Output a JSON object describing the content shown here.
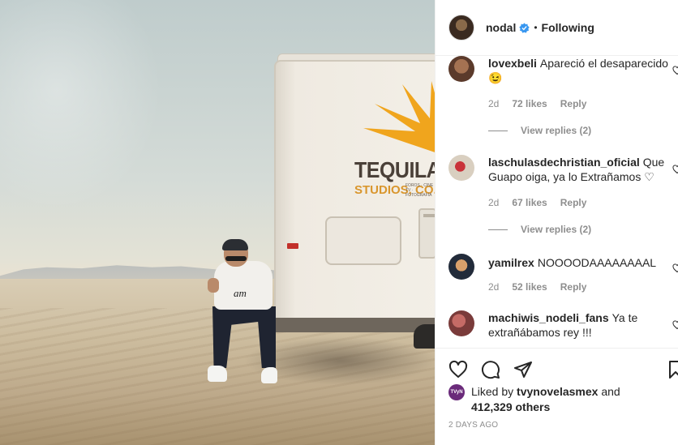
{
  "post": {
    "author": "nodal",
    "follow_state": "Following",
    "separator": "•",
    "image": {
      "trailer_brand": "TEQUILA FILM",
      "trailer_sub": "STUDIOS, CO.",
      "trailer_tiny": "FOROS · CINE · TV · FOTOGRAFÍA",
      "shirt_print": "am"
    },
    "comments": [
      {
        "user": "lovexbeli",
        "text": "Apareció el desaparecido😉",
        "age": "2d",
        "likes": "72 likes",
        "reply": "Reply",
        "view_replies": "View replies (2)"
      },
      {
        "user": "laschulasdechristian_oficial",
        "text": "Que Guapo oiga, ya lo Extrañamos ♡",
        "age": "2d",
        "likes": "67 likes",
        "reply": "Reply",
        "view_replies": "View replies (2)"
      },
      {
        "user": "yamilrex",
        "text": "NOOOODAAAAAAAAL",
        "age": "2d",
        "likes": "52 likes",
        "reply": "Reply"
      },
      {
        "user": "machiwis_nodeli_fans",
        "text": "Ya te extrañábamos rey !!!"
      }
    ],
    "liked_by": {
      "prefix": "Liked by",
      "user": "tvynovelasmex",
      "conj": "and",
      "count": "412,329 others",
      "avatar_text": "TVyN"
    },
    "timestamp": "2 DAYS AGO"
  },
  "colors": {
    "verified": "#3897f0",
    "text": "#262626",
    "muted": "#8e8e8e",
    "sun": "#f0a51d"
  },
  "icons": [
    "verified-badge-icon",
    "heart-icon",
    "comment-icon",
    "share-icon",
    "bookmark-icon"
  ]
}
